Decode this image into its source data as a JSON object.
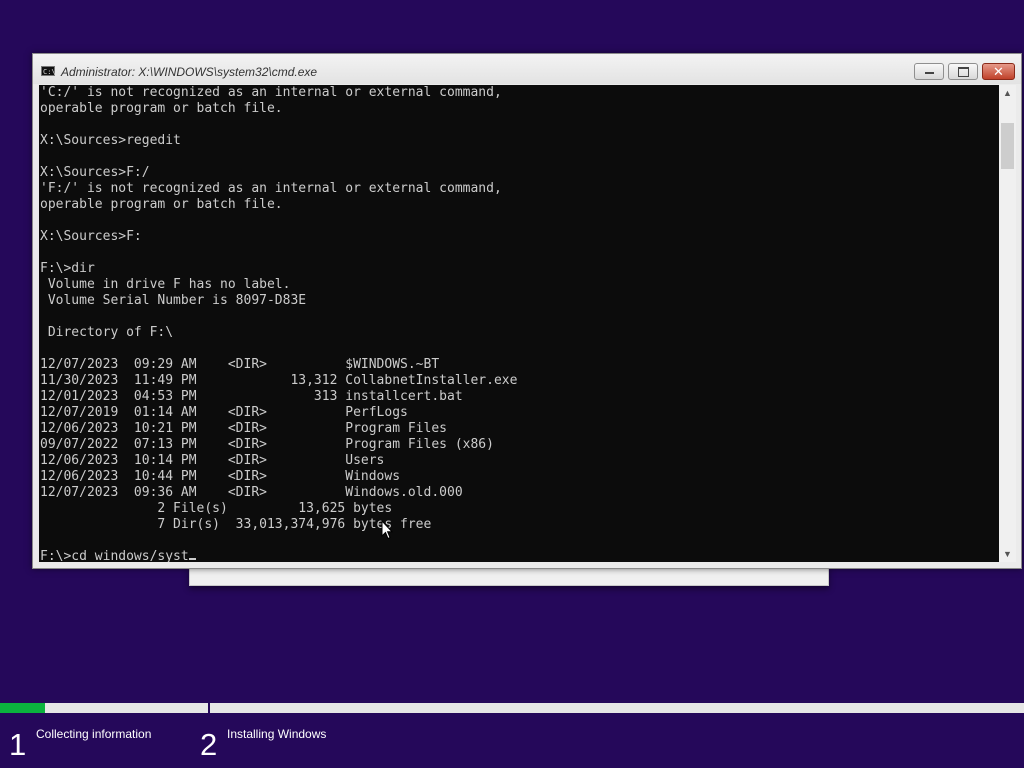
{
  "window": {
    "title": "Administrator: X:\\WINDOWS\\system32\\cmd.exe",
    "icon": "cmd-console-icon",
    "controls": {
      "minimize": "minimize-icon",
      "maximize": "maximize-icon",
      "close": "close-icon",
      "close_glyph": "✕"
    }
  },
  "console": {
    "lines": [
      "'C:/' is not recognized as an internal or external command,",
      "operable program or batch file.",
      "",
      "X:\\Sources>regedit",
      "",
      "X:\\Sources>F:/",
      "'F:/' is not recognized as an internal or external command,",
      "operable program or batch file.",
      "",
      "X:\\Sources>F:",
      "",
      "F:\\>dir",
      " Volume in drive F has no label.",
      " Volume Serial Number is 8097-D83E",
      "",
      " Directory of F:\\",
      "",
      "12/07/2023  09:29 AM    <DIR>          $WINDOWS.~BT",
      "11/30/2023  11:49 PM            13,312 CollabnetInstaller.exe",
      "12/01/2023  04:53 PM               313 installcert.bat",
      "12/07/2019  01:14 AM    <DIR>          PerfLogs",
      "12/06/2023  10:21 PM    <DIR>          Program Files",
      "09/07/2022  07:13 PM    <DIR>          Program Files (x86)",
      "12/06/2023  10:14 PM    <DIR>          Users",
      "12/06/2023  10:44 PM    <DIR>          Windows",
      "12/07/2023  09:36 AM    <DIR>          Windows.old.000",
      "               2 File(s)         13,625 bytes",
      "               7 Dir(s)  33,013,374,976 bytes free",
      ""
    ],
    "current_input": "F:\\>cd windows/syst"
  },
  "setup": {
    "progress_fraction": 0.044,
    "progress_color": "#0bb23e",
    "background_color": "#25085a",
    "steps": [
      {
        "number": "1",
        "label": "Collecting information"
      },
      {
        "number": "2",
        "label": "Installing Windows"
      }
    ]
  }
}
